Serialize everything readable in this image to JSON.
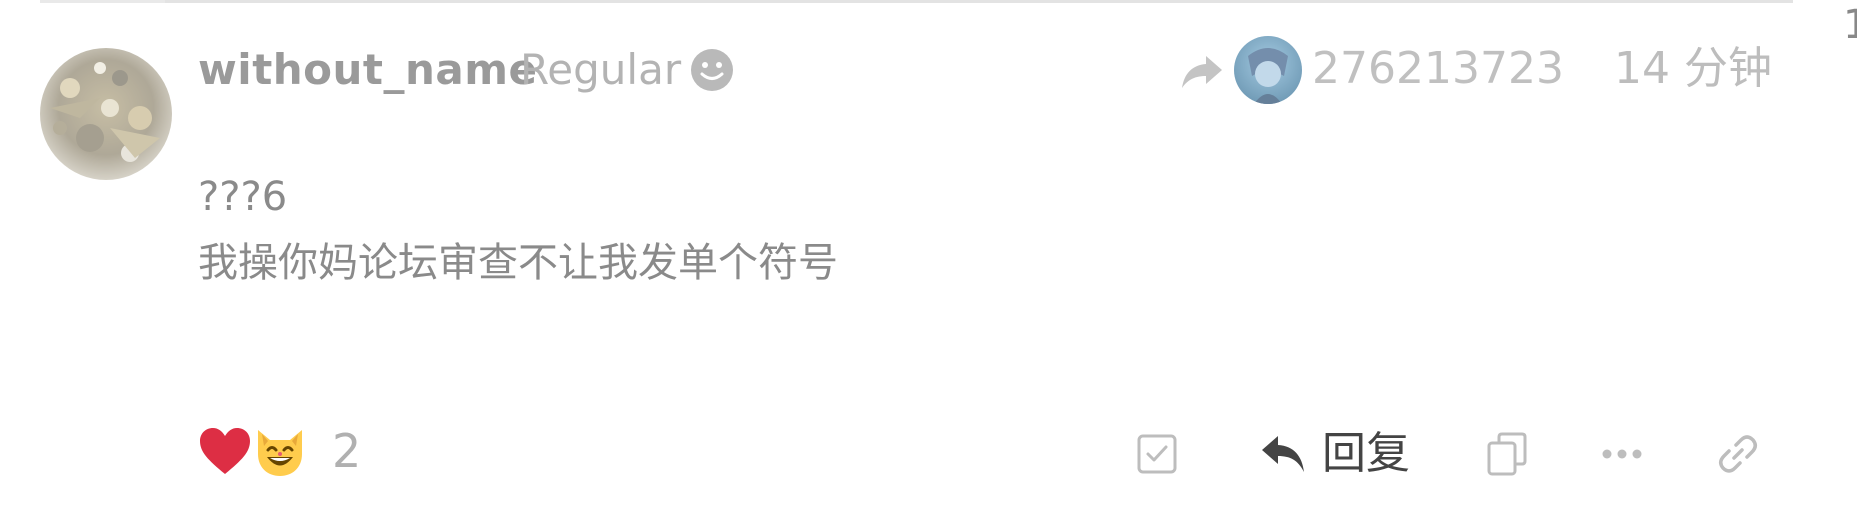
{
  "corner": {
    "number": "1"
  },
  "post": {
    "username": "without_name",
    "user_title": "Regular",
    "reply_to_user": "276213723",
    "time": "14 分钟",
    "body_lines": [
      "???6",
      "我操你妈论坛审查不让我发单个符号"
    ]
  },
  "reactions": {
    "emojis": [
      "heart",
      "grinning-cat"
    ],
    "count": "2"
  },
  "actions": {
    "reply_label": "回复"
  },
  "icons": {
    "user_status": "smiley-icon",
    "reply_to": "share-arrow-icon",
    "bookmark": "check-square-icon",
    "reply": "reply-arrow-icon",
    "copy": "copy-icon",
    "more": "more-dots-icon",
    "link": "link-icon"
  },
  "colors": {
    "heart": "#dd2e44",
    "cat": "#ffcc4d",
    "icon_muted": "#bdbdbd",
    "icon_dark": "#444444"
  }
}
